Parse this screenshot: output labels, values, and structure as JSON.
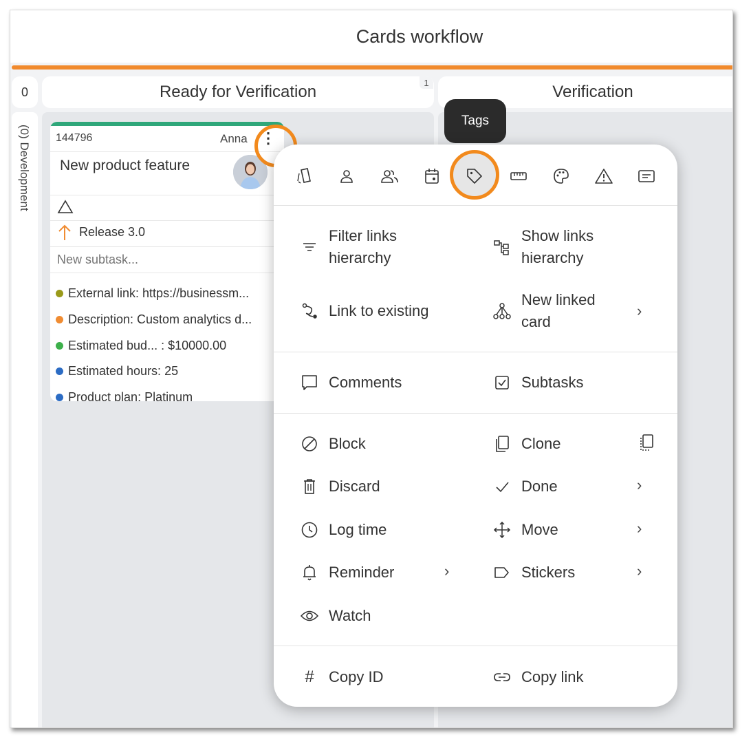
{
  "header": {
    "title": "Cards workflow"
  },
  "lanes": {
    "development": {
      "count": "0",
      "label": "(0) Development"
    },
    "ready_for_verification": {
      "title": "Ready for Verification",
      "wip": "1"
    },
    "verification": {
      "title": "Verification"
    }
  },
  "card": {
    "id": "144796",
    "owner": "Anna",
    "title": "New product feature",
    "release": "Release 3.0",
    "subtask_placeholder": "New subtask...",
    "fields": [
      {
        "label": "External link: https://businessm...",
        "color": "#9a9a1a"
      },
      {
        "label": "Description: Custom analytics d...",
        "color": "#f08c32"
      },
      {
        "label": "Estimated bud... : $10000.00",
        "color": "#3db04b"
      },
      {
        "label": "Estimated hours: 25",
        "color": "#2c6cc4"
      },
      {
        "label": "Product plan: Platinum",
        "color": "#2c6cc4"
      }
    ]
  },
  "tooltip": {
    "text": "Tags"
  },
  "popup": {
    "toolbar_icons": [
      "card-type-icon",
      "user-icon",
      "users-icon",
      "calendar-icon",
      "tag-icon",
      "ruler-icon",
      "palette-icon",
      "warning-icon",
      "note-icon"
    ],
    "items": {
      "filter_links": "Filter links\nhierarchy",
      "show_links": "Show links\nhierarchy",
      "link_existing": "Link to existing",
      "new_linked": "New linked\ncard",
      "comments": "Comments",
      "subtasks": "Subtasks",
      "block": "Block",
      "clone": "Clone",
      "discard": "Discard",
      "done": "Done",
      "log_time": "Log time",
      "move": "Move",
      "reminder": "Reminder",
      "stickers": "Stickers",
      "watch": "Watch",
      "copy_id": "Copy ID",
      "copy_link": "Copy link"
    }
  },
  "colors": {
    "accent_orange": "#f28a1d",
    "card_bar_green": "#2fa77a"
  }
}
